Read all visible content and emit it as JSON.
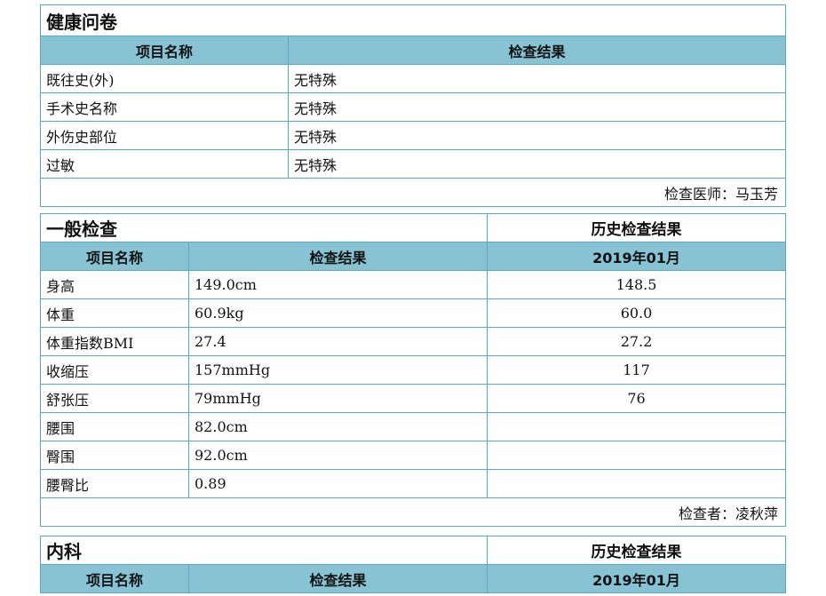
{
  "questionnaire": {
    "title": "健康问卷",
    "headers": [
      "项目名称",
      "检查结果"
    ],
    "rows": [
      {
        "item": "既往史(外)",
        "result": "无特殊"
      },
      {
        "item": "手术史名称",
        "result": "无特殊"
      },
      {
        "item": "外伤史部位",
        "result": "无特殊"
      },
      {
        "item": "过敏",
        "result": "无特殊"
      }
    ],
    "signature": "检查医师：马玉芳"
  },
  "general": {
    "title": "一般检查",
    "history_title": "历史检查结果",
    "headers": [
      "项目名称",
      "检查结果"
    ],
    "history_date": "2019年01月",
    "rows": [
      {
        "item": "身高",
        "result": "149.0cm",
        "history": "148.5"
      },
      {
        "item": "体重",
        "result": "60.9kg",
        "history": "60.0"
      },
      {
        "item": "体重指数BMI",
        "result": "27.4",
        "history": "27.2"
      },
      {
        "item": "收缩压",
        "result": "157mmHg",
        "history": "117"
      },
      {
        "item": "舒张压",
        "result": "79mmHg",
        "history": "76"
      },
      {
        "item": "腰围",
        "result": "82.0cm",
        "history": ""
      },
      {
        "item": "臀围",
        "result": "92.0cm",
        "history": ""
      },
      {
        "item": "腰臀比",
        "result": "0.89",
        "history": ""
      }
    ],
    "signature": "检查者：凌秋萍"
  },
  "internal": {
    "title": "内科",
    "history_title": "历史检查结果",
    "headers": [
      "项目名称",
      "检查结果"
    ],
    "history_date": "2019年01月"
  }
}
